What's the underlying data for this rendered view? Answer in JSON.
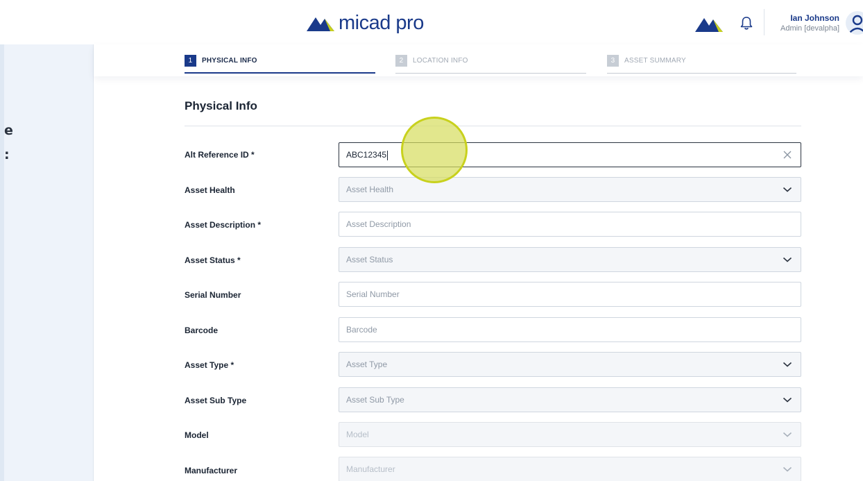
{
  "header": {
    "brand": "micad pro",
    "user_name": "Ian Johnson",
    "user_role": "Admin [devalpha]",
    "icons": [
      "brand-mark-icon",
      "bell-icon",
      "user-avatar-icon"
    ]
  },
  "left_panel": {
    "fragments": [
      "e",
      ":"
    ]
  },
  "stepper": {
    "steps": [
      {
        "num": "1",
        "label": "PHYSICAL INFO",
        "state": "active"
      },
      {
        "num": "2",
        "label": "LOCATION INFO",
        "state": "inactive"
      },
      {
        "num": "3",
        "label": "ASSET SUMMARY",
        "state": "inactive"
      }
    ]
  },
  "form": {
    "title": "Physical Info",
    "fields": [
      {
        "label": "Alt Reference ID *",
        "value": "ABC12345",
        "placeholder": "",
        "kind": "text",
        "state": "focused"
      },
      {
        "label": "Asset Health",
        "value": "",
        "placeholder": "Asset Health",
        "kind": "select",
        "state": "normal"
      },
      {
        "label": "Asset Description *",
        "value": "",
        "placeholder": "Asset Description",
        "kind": "text",
        "state": "normal"
      },
      {
        "label": "Asset Status *",
        "value": "",
        "placeholder": "Asset Status",
        "kind": "select",
        "state": "normal"
      },
      {
        "label": "Serial Number",
        "value": "",
        "placeholder": "Serial Number",
        "kind": "text",
        "state": "normal"
      },
      {
        "label": "Barcode",
        "value": "",
        "placeholder": "Barcode",
        "kind": "text",
        "state": "normal"
      },
      {
        "label": "Asset Type *",
        "value": "",
        "placeholder": "Asset Type",
        "kind": "select",
        "state": "normal"
      },
      {
        "label": "Asset Sub Type",
        "value": "",
        "placeholder": "Asset Sub Type",
        "kind": "select",
        "state": "normal"
      },
      {
        "label": "Model",
        "value": "",
        "placeholder": "Model",
        "kind": "select",
        "state": "disabled"
      },
      {
        "label": "Manufacturer",
        "value": "",
        "placeholder": "Manufacturer",
        "kind": "select",
        "state": "disabled"
      }
    ]
  },
  "colors": {
    "brand_blue": "#1a3a8a",
    "brand_lime": "#c8d11d",
    "accent_step": "#1a3a8a"
  }
}
